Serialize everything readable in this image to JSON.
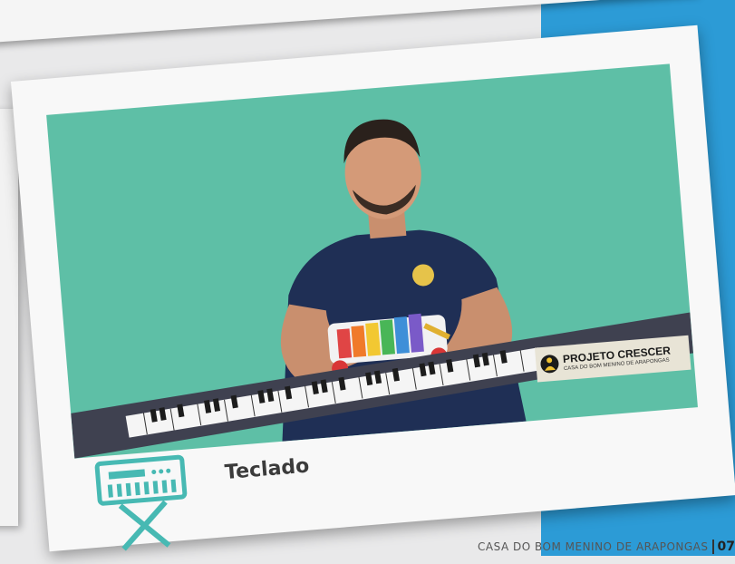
{
  "caption": "Teclado",
  "footer": {
    "text": "CASA DO BOM MENINO DE ARAPONGAS",
    "page": "07"
  },
  "logo": {
    "title": "PROJETO CRESCER",
    "subtitle": "CASA DO BOM MENINO DE ARAPONGAS"
  },
  "colors": {
    "background_blue": "#2c9bd6",
    "photo_green": "#5ebfa6",
    "icon_teal": "#47b9b3"
  },
  "icons": [
    "keyboard-stand-icon"
  ]
}
